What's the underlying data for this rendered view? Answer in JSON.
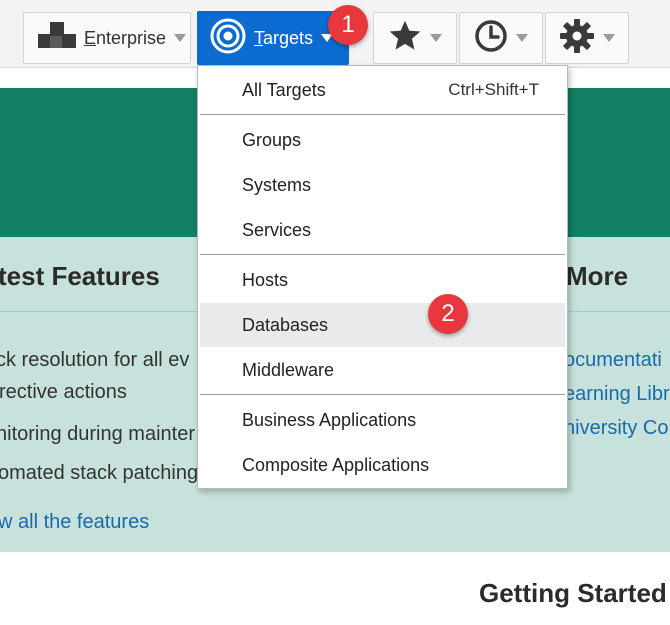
{
  "toolbar": {
    "enterprise": {
      "label_first": "E",
      "label_rest": "nterprise"
    },
    "targets": {
      "label_first": "T",
      "label_rest": "argets"
    }
  },
  "callouts": [
    "1",
    "2"
  ],
  "page": {
    "left_title": "test Features",
    "right_title": "More",
    "left_items": [
      "ck resolution for all ev",
      "rective actions",
      "nitoring during mainter",
      "omated stack patching"
    ],
    "view_all_link": "w all the features",
    "right_links": [
      "ocumentati",
      "earning Libr",
      "niversity Co"
    ],
    "getting_started": "Getting Started"
  },
  "targets_menu": {
    "items": [
      {
        "label": "All Targets",
        "shortcut": "Ctrl+Shift+T"
      },
      {
        "label": "Groups"
      },
      {
        "label": "Systems"
      },
      {
        "label": "Services"
      },
      {
        "label": "Hosts"
      },
      {
        "label": "Databases",
        "highlighted": true
      },
      {
        "label": "Middleware"
      },
      {
        "label": "Business Applications"
      },
      {
        "label": "Composite Applications"
      }
    ]
  },
  "colors": {
    "accent": "#0b6bd1",
    "banner": "#137f63",
    "features_bg": "#c7e2dc",
    "callout": "#e8383d",
    "link": "#1a6aa8"
  },
  "icons": [
    "enterprise-icon",
    "targets-icon",
    "star-icon",
    "history-icon",
    "gear-icon"
  ]
}
